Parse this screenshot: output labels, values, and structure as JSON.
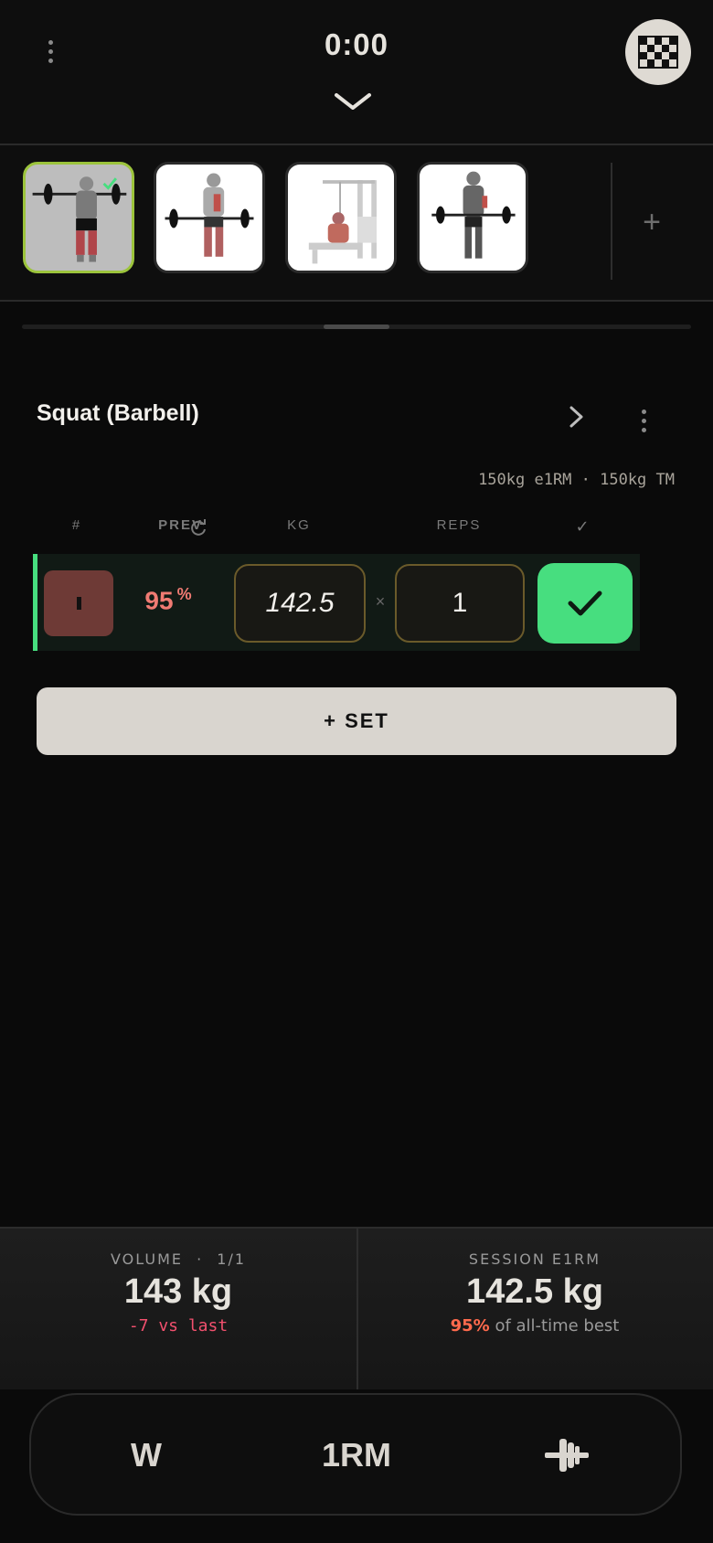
{
  "header": {
    "timer": "0:00"
  },
  "exercise": {
    "title": "Squat (Barbell)",
    "metrics": "150kg e1RM · 150kg TM"
  },
  "columns": {
    "num": "#",
    "prev": "PREV",
    "kg": "KG",
    "reps": "REPS",
    "done": "✓"
  },
  "sets": [
    {
      "prev_value": "95",
      "prev_unit": "%",
      "kg": "142.5",
      "times": "×",
      "reps": "1"
    }
  ],
  "add_set_label": "+ SET",
  "stats": {
    "volume_label": "VOLUME",
    "volume_sep": "·",
    "volume_count": "1/1",
    "volume_value": "143",
    "volume_unit": "kg",
    "volume_delta": "-7 vs last",
    "e1rm_label": "SESSION E1RM",
    "e1rm_value": "142.5 kg",
    "e1rm_percent": "95%",
    "e1rm_suffix": "of all-time best"
  },
  "bottom_bar": {
    "warmup_label": "W",
    "one_rm_label": "1RM",
    "plate_icon": "plate-calculator-icon"
  },
  "colors": {
    "accent_green": "#47de7f",
    "active_thumb_border": "#9cc43c",
    "prev_red": "#f07b73",
    "delta_pink": "#f2506e",
    "percent_orange": "#ff6a4d"
  }
}
